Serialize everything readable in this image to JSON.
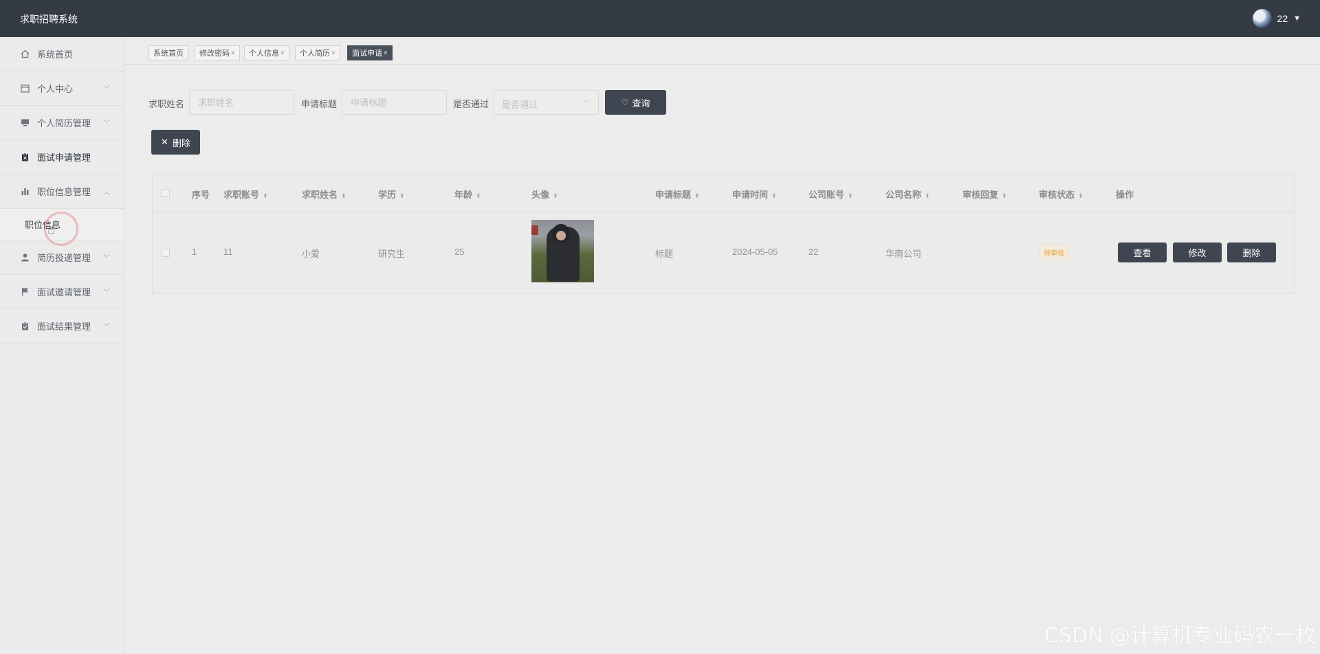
{
  "header": {
    "app_title": "求职招聘系统",
    "user_name": "22"
  },
  "sidebar": {
    "items": [
      {
        "label": "系统首页",
        "icon": "home-icon"
      },
      {
        "label": "个人中心",
        "icon": "calendar-icon"
      },
      {
        "label": "个人简历管理",
        "icon": "monitor-icon"
      },
      {
        "label": "面试申请管理",
        "icon": "clipboard-icon"
      },
      {
        "label": "职位信息管理",
        "icon": "bar-chart-icon"
      },
      {
        "label": "简历投递管理",
        "icon": "user-icon"
      },
      {
        "label": "面试邀请管理",
        "icon": "flag-icon"
      },
      {
        "label": "面试结果管理",
        "icon": "check-clipboard-icon"
      }
    ],
    "submenu": {
      "label": "职位信息"
    }
  },
  "tabs": [
    {
      "label": "系统首页",
      "closable": false
    },
    {
      "label": "修改密码",
      "closable": true
    },
    {
      "label": "个人信息",
      "closable": true
    },
    {
      "label": "个人简历",
      "closable": true
    },
    {
      "label": "面试申请",
      "closable": true,
      "active": true
    }
  ],
  "tab_close_glyph": "×",
  "search": {
    "name_label": "求职姓名",
    "name_placeholder": "求职姓名",
    "title_label": "申请标题",
    "title_placeholder": "申请标题",
    "pass_label": "是否通过",
    "pass_placeholder": "是否通过",
    "query_button": "查询"
  },
  "actions": {
    "delete_button": "删除"
  },
  "table": {
    "columns": [
      "序号",
      "求职账号",
      "求职姓名",
      "学历",
      "年龄",
      "头像",
      "申请标题",
      "申请时间",
      "公司账号",
      "公司名称",
      "审核回复",
      "审核状态",
      "操作"
    ],
    "rows": [
      {
        "index": "1",
        "account": "11",
        "name": "小爱",
        "education": "研究生",
        "age": "25",
        "title": "标题",
        "apply_time": "2024-05-05",
        "company_account": "22",
        "company_name": "华南公司",
        "review_reply": "",
        "review_status": "待审核",
        "view_button": "查看",
        "edit_button": "修改",
        "delete_button": "删除"
      }
    ]
  },
  "watermark": "CSDN @计算机专业码农一枚",
  "colors": {
    "header_bg": "#353b45",
    "button_dark": "#3f4651",
    "status_pending": "#e6a23c"
  }
}
